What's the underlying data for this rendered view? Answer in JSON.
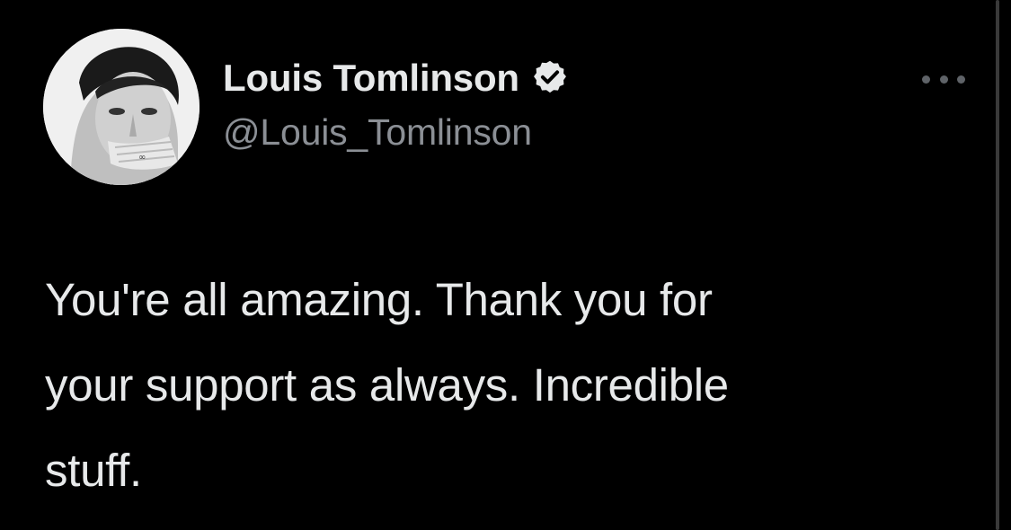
{
  "tweet": {
    "author": {
      "display_name": "Louis Tomlinson",
      "handle": "@Louis_Tomlinson",
      "verified": true,
      "avatar_icon": "avatar-photo"
    },
    "more_icon": "more-options-icon",
    "text": "You're all amazing. Thank you for\nyour support as always. Incredible\nstuff."
  },
  "colors": {
    "background": "#000000",
    "text_primary": "#e7e9ea",
    "text_secondary": "#8b8f95",
    "verified_badge": "#e7e9ea"
  }
}
